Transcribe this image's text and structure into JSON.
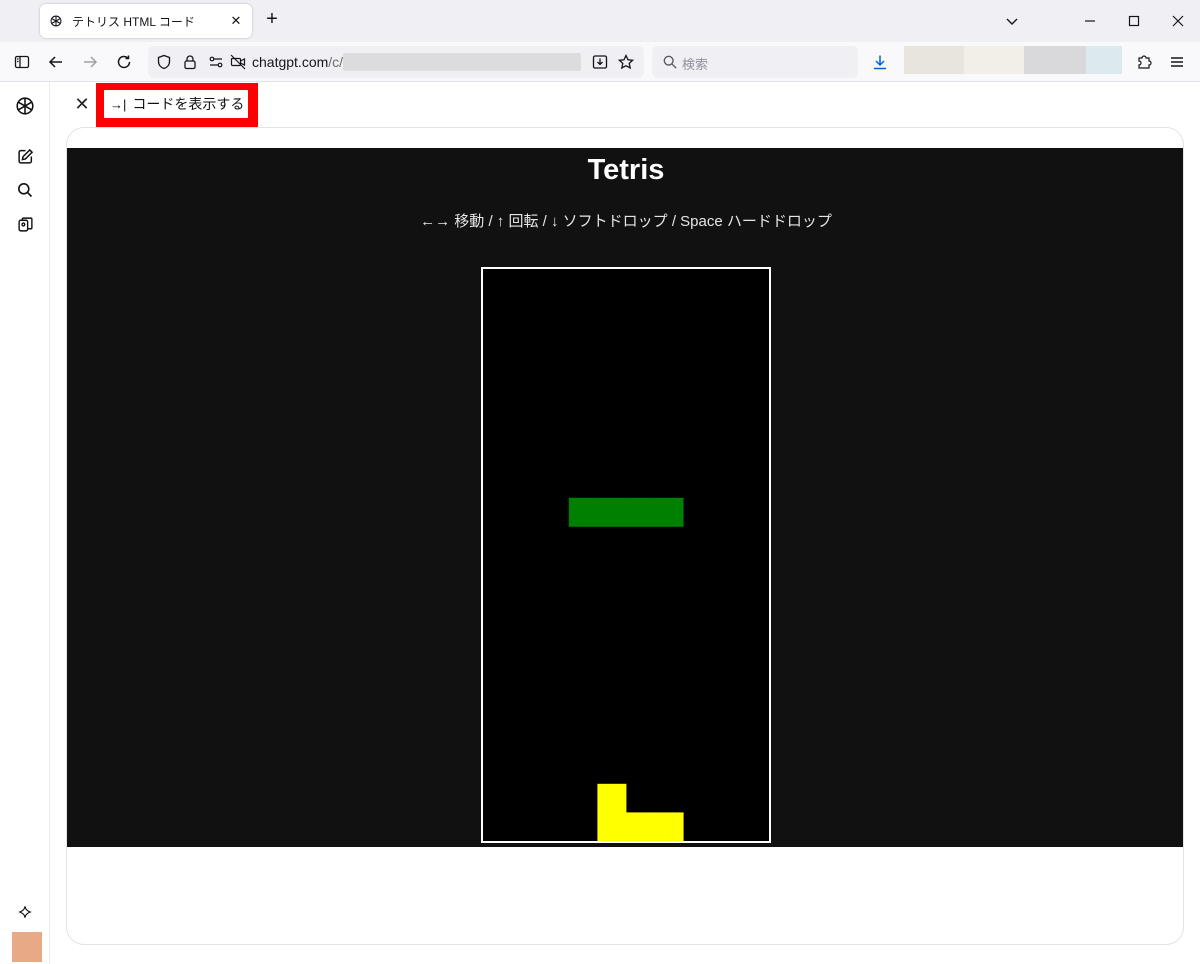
{
  "browser": {
    "tab_title": "テトリス HTML コード",
    "url_host": "chatgpt.com",
    "url_path": "/c/",
    "search_placeholder": "検索",
    "swatches": [
      "#e8e4de",
      "#f2eee8",
      "#d9d9db",
      "#dce9ef"
    ]
  },
  "page": {
    "show_code_label": "コードを表示する",
    "show_code_arrow": "→|"
  },
  "game": {
    "title": "Tetris",
    "help": "←→ 移動 / ↑ 回転 / ↓ ソフトドロップ / Space ハードドロップ",
    "board": {
      "cols": 10,
      "rows": 20
    },
    "active_piece": {
      "type": "I",
      "color": "#008000",
      "cells": [
        [
          3,
          8
        ],
        [
          4,
          8
        ],
        [
          5,
          8
        ],
        [
          6,
          8
        ]
      ]
    },
    "locked_cells": {
      "color": "#ffff00",
      "cells": [
        [
          4,
          18
        ],
        [
          4,
          19
        ],
        [
          5,
          19
        ],
        [
          6,
          19
        ]
      ]
    }
  },
  "icons": {
    "favicon": "openai-icon",
    "sidebar": [
      "openai-icon",
      "new-chat-icon",
      "search-icon",
      "library-icon",
      "sparkle-icon"
    ]
  }
}
